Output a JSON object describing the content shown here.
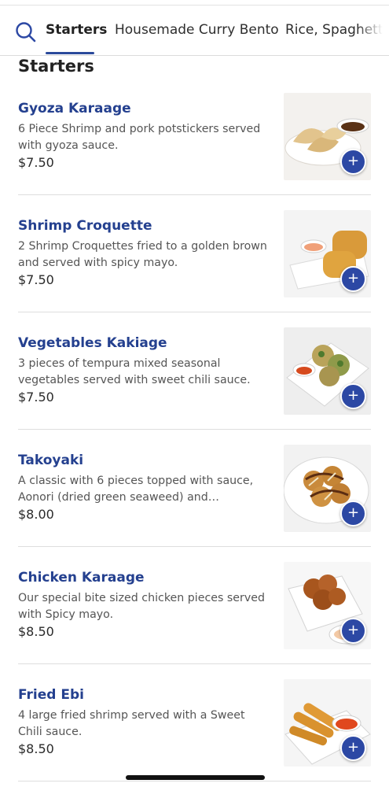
{
  "tabs": [
    {
      "label": "Starters",
      "active": true
    },
    {
      "label": "Housemade Curry Bento",
      "active": false
    },
    {
      "label": "Rice, Spaghetti",
      "active": false
    }
  ],
  "section": {
    "title": "Starters"
  },
  "items": [
    {
      "name": "Gyoza Karaage",
      "desc": "6 Piece Shrimp and pork potstickers served with gyoza sauce.",
      "price": "$7.50",
      "add_label": "+"
    },
    {
      "name": "Shrimp Croquette",
      "desc": "2 Shrimp Croquettes fried to a golden brown and served with spicy mayo.",
      "price": "$7.50",
      "add_label": "+"
    },
    {
      "name": "Vegetables Kakiage",
      "desc": "3 pieces of tempura mixed seasonal vegetables served with sweet chili sauce.",
      "price": "$7.50",
      "add_label": "+"
    },
    {
      "name": "Takoyaki",
      "desc": "A classic with 6 pieces topped with sauce, Aonori (dried green seaweed) and…",
      "price": "$8.00",
      "add_label": "+"
    },
    {
      "name": "Chicken Karaage",
      "desc": "Our special bite sized chicken pieces served with Spicy mayo.",
      "price": "$8.50",
      "add_label": "+"
    },
    {
      "name": "Fried Ebi",
      "desc": "4 large fried shrimp served with a Sweet Chili sauce.",
      "price": "$8.50",
      "add_label": "+"
    }
  ],
  "icons": {
    "search": "search-icon",
    "add": "plus-icon"
  },
  "colors": {
    "accent": "#2c48a4",
    "item_name": "#24408f"
  }
}
